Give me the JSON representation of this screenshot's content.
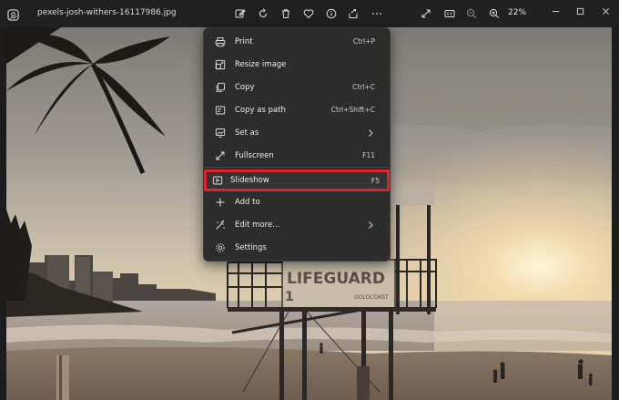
{
  "window": {
    "filename": "pexels-josh-withers-16117986.jpg",
    "zoom_label": "22%"
  },
  "toolbar": {
    "icons": [
      "edit-icon",
      "rotate-icon",
      "delete-icon",
      "favorite-icon",
      "info-icon",
      "share-icon",
      "more-icon"
    ],
    "right_icons": [
      "fullscreen-icon",
      "actual-size-icon",
      "zoom-out-icon",
      "zoom-in-icon"
    ]
  },
  "photo": {
    "sign_text": "LIFEGUARD",
    "sign_sub": "GOLDCOAST",
    "sign_number": "1"
  },
  "menu": {
    "items": [
      {
        "label": "Print",
        "shortcut": "Ctrl+P",
        "icon": "print-icon"
      },
      {
        "label": "Resize image",
        "shortcut": "",
        "icon": "resize-icon"
      },
      {
        "label": "Copy",
        "shortcut": "Ctrl+C",
        "icon": "copy-icon"
      },
      {
        "label": "Copy as path",
        "shortcut": "Ctrl+Shift+C",
        "icon": "copy-path-icon"
      },
      {
        "label": "Set as",
        "shortcut": "",
        "icon": "set-as-icon"
      },
      {
        "label": "Fullscreen",
        "shortcut": "F11",
        "icon": "fullscreen-icon"
      },
      {
        "label": "Slideshow",
        "shortcut": "F5",
        "icon": "slideshow-icon"
      },
      {
        "label": "Add to",
        "shortcut": "",
        "icon": "add-icon"
      },
      {
        "label": "Edit more...",
        "shortcut": "",
        "icon": "edit-more-icon"
      },
      {
        "label": "Settings",
        "shortcut": "",
        "icon": "settings-icon"
      }
    ]
  },
  "colors": {
    "highlight_border": "#e0212e",
    "menu_bg": "#2c2c2c",
    "titlebar_bg": "#202020"
  }
}
